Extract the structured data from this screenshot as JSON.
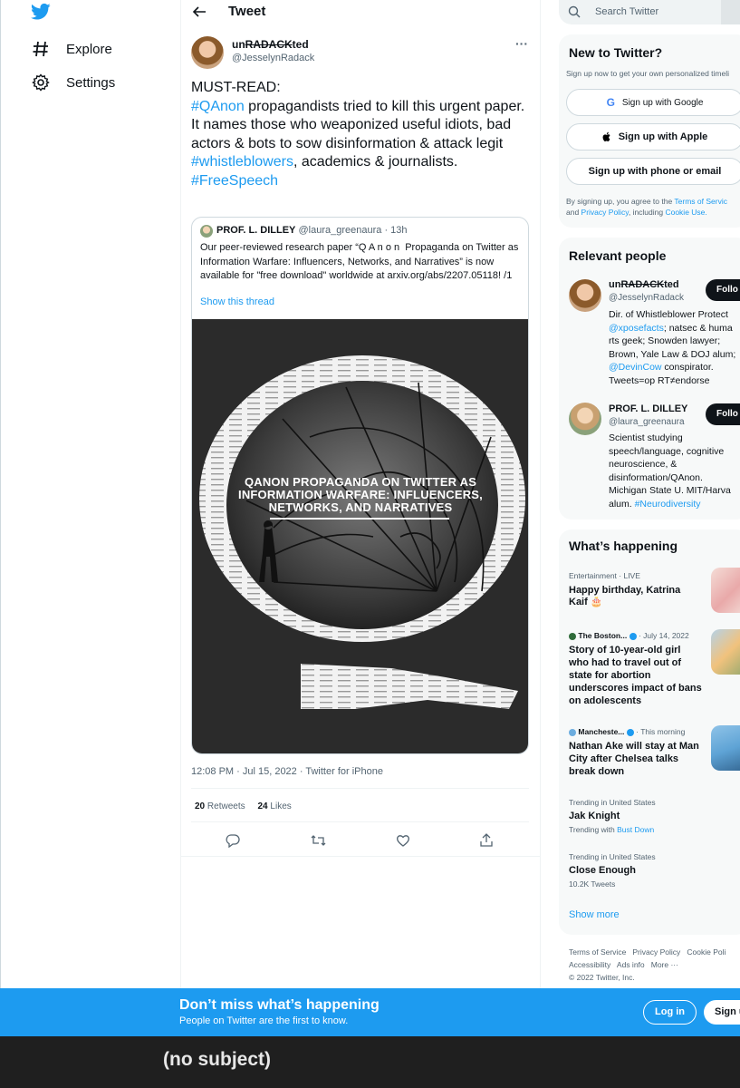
{
  "nav": {
    "explore": "Explore",
    "settings": "Settings"
  },
  "header": {
    "title": "Tweet"
  },
  "tweet": {
    "display_name": "unRADACKted",
    "name_prefix": "un",
    "name_struck": "RADACK",
    "name_suffix": "ted",
    "handle": "@JesselynRadack",
    "text_line_1": "MUST-READ:",
    "hashtag_qanon": "#QAnon",
    "text_2": " propagandists tried to kill this urgent paper. It names those who weaponized useful idiots, bad actors & bots to sow disinformation & attack legit ",
    "hashtag_whistleblowers": "#whistleblowers",
    "text_3": ", academics & journalists.",
    "hashtag_freespeech": "#FreeSpeech",
    "timestamp": "12:08 PM · Jul 15, 2022 · Twitter for iPhone",
    "retweets_count": "20",
    "retweets_label": "Retweets",
    "likes_count": "24",
    "likes_label": "Likes"
  },
  "quote": {
    "name": "PROF. L. DILLEY",
    "handle": "@laura_greenaura",
    "age": "· 13h",
    "text": "Our peer-reviewed research paper “Q A n o n  Propaganda on Twitter as Information Warfare: Influencers, Networks, and Narratives” is now available for \"free download\" worldwide at arxiv.org/abs/2207.05118! /1",
    "show_thread": "Show this thread",
    "image_title_1": "QANON PROPAGANDA ON TWITTER AS",
    "image_title_2": "INFORMATION WARFARE: INFLUENCERS,",
    "image_title_3": "NETWORKS, AND NARRATIVES"
  },
  "search": {
    "placeholder": "Search Twitter"
  },
  "new_to_twitter": {
    "title": "New to Twitter?",
    "subtitle": "Sign up now to get your own personalized timeli",
    "google": "Sign up with Google",
    "apple": "Sign up with Apple",
    "phone": "Sign up with phone or email",
    "terms_1": "By signing up, you agree to the ",
    "terms_link": "Terms of Servic",
    "terms_2": "and ",
    "privacy_link": "Privacy Policy",
    "terms_3": ", including ",
    "cookie_link": "Cookie Use."
  },
  "relevant": {
    "title": "Relevant people",
    "follow": "Follo",
    "p1_handle": "@JesselynRadack",
    "p1_bio_1": "Dir. of Whistleblower Protect",
    "p1_bio_link": "@xposefacts",
    "p1_bio_2": "; natsec & huma",
    "p1_bio_3": "rts geek; Snowden lawyer;",
    "p1_bio_4": "Brown, Yale Law & DOJ alum;",
    "p1_bio_link2": "@DevinCow",
    "p1_bio_5": " conspirator.",
    "p1_bio_6": "Tweets=op RT≠endorse",
    "p2_name": "PROF. L. DILLEY",
    "p2_handle": "@laura_greenaura",
    "p2_bio_1": "Scientist studying",
    "p2_bio_2": "speech/language, cognitive",
    "p2_bio_3": "neuroscience, &",
    "p2_bio_4": "disinformation/QAnon.",
    "p2_bio_5": "Michigan State U. MIT/Harva",
    "p2_bio_6": "alum. ",
    "p2_bio_link": "#Neurodiversity"
  },
  "happening": {
    "title": "What’s happening",
    "t1_meta": "Entertainment · LIVE",
    "t1_title_1": "Happy birthday, Katrina",
    "t1_title_2": "Kaif 🎂",
    "t2_source": "The Boston...",
    "t2_date": "· July 14, 2022",
    "t2_title_1": "Story of 10-year-old girl",
    "t2_title_2": "who had to travel out of",
    "t2_title_3": "state for abortion",
    "t2_title_4": "underscores impact of bans",
    "t2_title_5": "on adolescents",
    "t3_source": "Mancheste...",
    "t3_date": "· This morning",
    "t3_title_1": "Nathan Ake will stay at Man",
    "t3_title_2": "City after Chelsea talks",
    "t3_title_3": "break down",
    "t4_meta": "Trending in United States",
    "t4_title": "Jak Knight",
    "t4_sub": "Trending with ",
    "t4_sub_link": "Bust Down",
    "t5_meta": "Trending in United States",
    "t5_title": "Close Enough",
    "t5_sub": "10.2K Tweets",
    "show_more": "Show more"
  },
  "footer": {
    "terms": "Terms of Service",
    "privacy": "Privacy Policy",
    "cookie": "Cookie Poli",
    "accessibility": "Accessibility",
    "ads": "Ads info",
    "more": "More ···",
    "copyright": "© 2022 Twitter, Inc."
  },
  "banner": {
    "title": "Don’t miss what’s happening",
    "subtitle": "People on Twitter are the first to know.",
    "login": "Log in",
    "signup": "Sign u"
  },
  "bottom": {
    "subject": "(no subject)"
  },
  "colors": {
    "accent": "#1d9bf0",
    "text": "#0f1419",
    "muted": "#536471"
  }
}
